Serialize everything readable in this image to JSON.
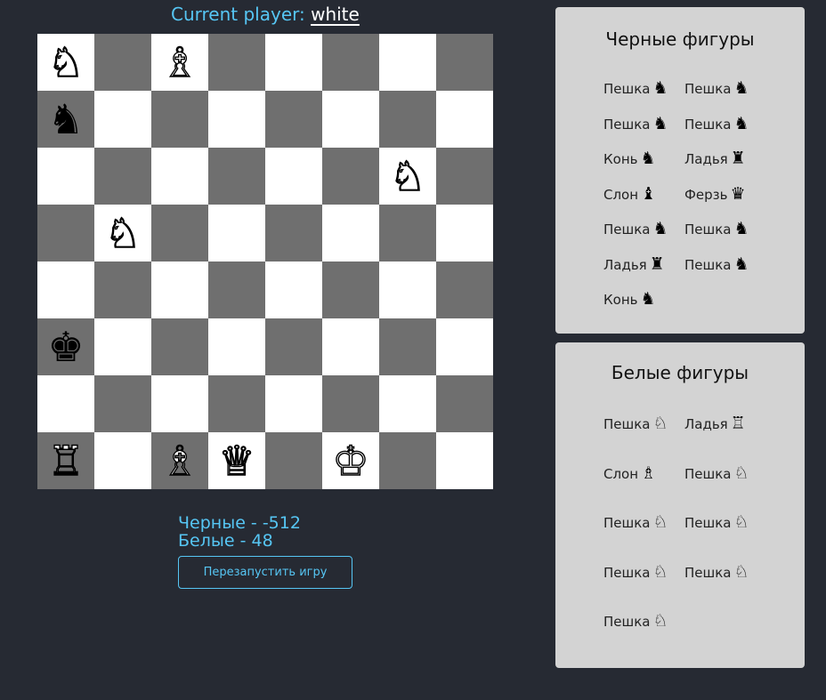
{
  "header": {
    "prefix": "Current player: ",
    "player": "white"
  },
  "board": {
    "rows": [
      [
        {
          "glyph": "♘",
          "color": "white"
        },
        null,
        {
          "glyph": "♗",
          "color": "white"
        },
        null,
        null,
        null,
        null,
        null
      ],
      [
        {
          "glyph": "♞",
          "color": "black"
        },
        null,
        null,
        null,
        null,
        null,
        null,
        null
      ],
      [
        null,
        null,
        null,
        null,
        null,
        null,
        {
          "glyph": "♘",
          "color": "white"
        },
        null
      ],
      [
        null,
        {
          "glyph": "♘",
          "color": "white"
        },
        null,
        null,
        null,
        null,
        null,
        null
      ],
      [
        null,
        null,
        null,
        null,
        null,
        null,
        null,
        null
      ],
      [
        {
          "glyph": "♚",
          "color": "black"
        },
        null,
        null,
        null,
        null,
        null,
        null,
        null
      ],
      [
        null,
        null,
        null,
        null,
        null,
        null,
        null,
        null
      ],
      [
        {
          "glyph": "♖",
          "color": "white"
        },
        null,
        {
          "glyph": "♗",
          "color": "white"
        },
        {
          "glyph": "♕",
          "color": "white"
        },
        null,
        {
          "glyph": "♔",
          "color": "white"
        },
        null,
        null
      ]
    ]
  },
  "score": {
    "black": "Черные - -512",
    "white": "Белые - 48"
  },
  "restart_label": "Перезапустить игру",
  "black_panel": {
    "title": "Черные фигуры",
    "items": [
      {
        "name": "Пешка",
        "glyph": "♞"
      },
      {
        "name": "Пешка",
        "glyph": "♞"
      },
      {
        "name": "Пешка",
        "glyph": "♞"
      },
      {
        "name": "Пешка",
        "glyph": "♞"
      },
      {
        "name": "Конь",
        "glyph": "♞"
      },
      {
        "name": "Ладья",
        "glyph": "♜"
      },
      {
        "name": "Слон",
        "glyph": "♝"
      },
      {
        "name": "Ферзь",
        "glyph": "♛"
      },
      {
        "name": "Пешка",
        "glyph": "♞"
      },
      {
        "name": "Пешка",
        "glyph": "♞"
      },
      {
        "name": "Ладья",
        "glyph": "♜"
      },
      {
        "name": "Пешка",
        "glyph": "♞"
      },
      {
        "name": "Конь",
        "glyph": "♞"
      }
    ]
  },
  "white_panel": {
    "title": "Белые фигуры",
    "items": [
      {
        "name": "Пешка",
        "glyph": "♘"
      },
      {
        "name": "Ладья",
        "glyph": "♖"
      },
      {
        "name": "Слон",
        "glyph": "♗"
      },
      {
        "name": "Пешка",
        "glyph": "♘"
      },
      {
        "name": "Пешка",
        "glyph": "♘"
      },
      {
        "name": "Пешка",
        "glyph": "♘"
      },
      {
        "name": "Пешка",
        "glyph": "♘"
      },
      {
        "name": "Пешка",
        "glyph": "♘"
      },
      {
        "name": "Пешка",
        "glyph": "♘"
      }
    ]
  }
}
